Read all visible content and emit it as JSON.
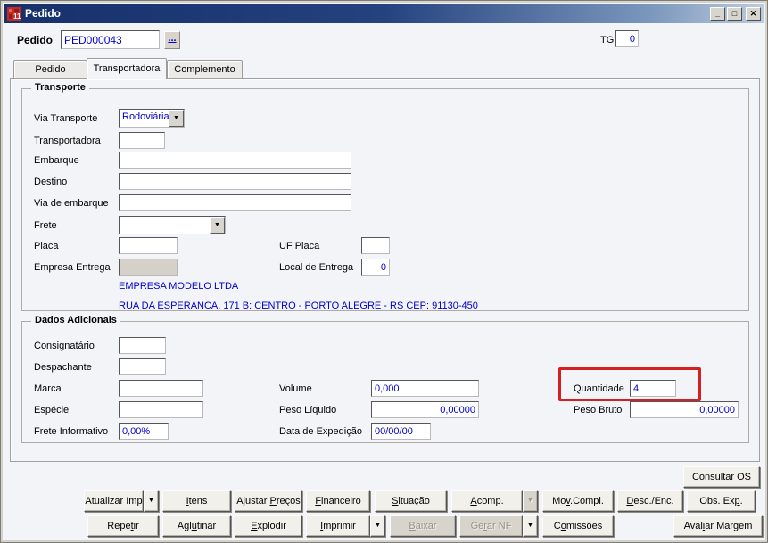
{
  "colors": {
    "titlebar_left": "#16306a",
    "titlebar_right": "#bdccdd",
    "value_text": "#0000cc",
    "highlight": "#d42020"
  },
  "icons": {
    "dropdown": "▼"
  },
  "window": {
    "title": "Pedido",
    "controls": {
      "minimize": "_",
      "maximize": "□",
      "close": "✕"
    }
  },
  "header": {
    "pedido_label": "Pedido",
    "pedido_value": "PED000043",
    "browse_label": "...",
    "tg_label": "TG",
    "tg_value": "0"
  },
  "tabs": [
    {
      "label": "Pedido",
      "active": false
    },
    {
      "label": "Transportadora",
      "active": true
    },
    {
      "label": "Complemento",
      "active": false
    }
  ],
  "transporte": {
    "title": "Transporte",
    "via_transporte_label": "Via Transporte",
    "via_transporte_value": "Rodoviária",
    "transportadora_label": "Transportadora",
    "transportadora_value": "",
    "embarque_label": "Embarque",
    "embarque_value": "",
    "destino_label": "Destino",
    "destino_value": "",
    "via_embarque_label": "Via de embarque",
    "via_embarque_value": "",
    "frete_label": "Frete",
    "frete_value": "",
    "placa_label": "Placa",
    "placa_value": "",
    "uf_placa_label": "UF Placa",
    "uf_placa_value": "",
    "empresa_entrega_label": "Empresa Entrega",
    "empresa_entrega_value": "",
    "local_entrega_label": "Local de Entrega",
    "local_entrega_value": "0",
    "empresa_nome": "EMPRESA MODELO LTDA",
    "empresa_endereco": "RUA DA ESPERANCA, 171 B: CENTRO - PORTO ALEGRE - RS CEP: 91130-450"
  },
  "dados_adicionais": {
    "title": "Dados Adicionais",
    "consignatario_label": "Consignatário",
    "consignatario_value": "",
    "despachante_label": "Despachante",
    "despachante_value": "",
    "marca_label": "Marca",
    "marca_value": "",
    "especie_label": "Espécie",
    "especie_value": "",
    "frete_informativo_label": "Frete Informativo",
    "frete_informativo_value": "0,00%",
    "volume_label": "Volume",
    "volume_value": "0,000",
    "peso_liquido_label": "Peso Líquido",
    "peso_liquido_value": "0,00000",
    "data_expedicao_label": "Data de Expedição",
    "data_expedicao_value": "00/00/00",
    "quantidade_label": "Quantidade",
    "quantidade_value": "4",
    "peso_bruto_label": "Peso Bruto",
    "peso_bruto_value": "0,00000"
  },
  "buttons": {
    "consultar_os": {
      "label": "Consultar OS"
    },
    "row1": [
      {
        "label": "Atualizar Imp"
      },
      {
        "label": "Itens",
        "mn": 0
      },
      {
        "label": "Ajustar Preços",
        "mn": 8
      },
      {
        "label": "Financeiro",
        "mn": 0
      },
      {
        "label": "Situação",
        "mn": 0
      },
      {
        "label": "Acomp.",
        "mn": 0
      },
      {
        "label": "Mov.Compl.",
        "mn": 2
      },
      {
        "label": "Desc./Enc.",
        "mn": 0
      },
      {
        "label": "Obs. Exp.",
        "mn": 7
      }
    ],
    "row2": [
      {
        "label": "Repetir",
        "mn": 4
      },
      {
        "label": "Aglutinar",
        "mn": 3
      },
      {
        "label": "Explodir",
        "mn": 0
      },
      {
        "label": "Imprimir",
        "mn": 0
      },
      {
        "label": "Baixar",
        "mn": 0,
        "disabled": true
      },
      {
        "label": "Gerar NF",
        "mn": 2,
        "disabled": true
      },
      {
        "label": "Comissões",
        "mn": 1
      },
      {
        "label": "Avaliar Margem",
        "mn": 4
      }
    ]
  }
}
